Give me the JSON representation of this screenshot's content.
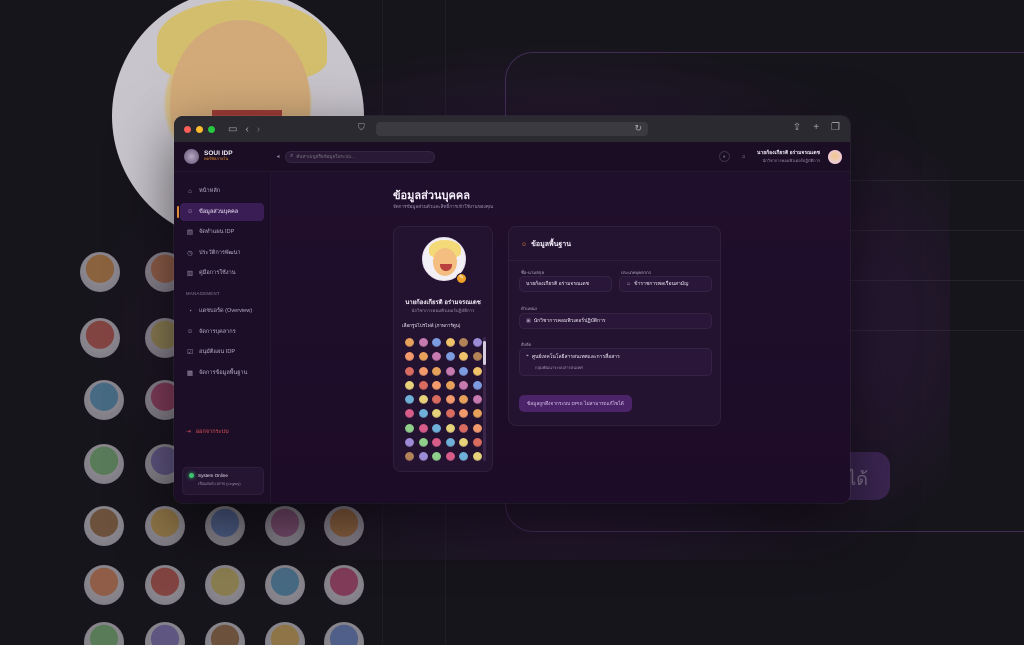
{
  "browser": {
    "controls": [
      "red",
      "yellow",
      "green"
    ]
  },
  "app": {
    "brand_name": "SOUI IDP",
    "brand_sub": "พอร์ทัลภายใน",
    "search_placeholder": "ค้นหาเมนูหรือข้อมูลในระบบ...",
    "user_name": "นายก้องเกียรติ อร่ามจรณเดช",
    "user_role": "นักวิชาการคอมพิวเตอร์ปฏิบัติการ"
  },
  "sidebar": {
    "items": [
      {
        "label": "หน้าหลัก",
        "icon": "home-icon"
      },
      {
        "label": "ข้อมูลส่วนบุคคล",
        "icon": "user-icon"
      },
      {
        "label": "จัดทำแผน IDP",
        "icon": "file-icon"
      },
      {
        "label": "ประวัติการพัฒนา",
        "icon": "history-icon"
      },
      {
        "label": "คู่มือการใช้งาน",
        "icon": "book-icon"
      }
    ],
    "section_label": "MANAGEMENT",
    "management_items": [
      {
        "label": "แดชบอร์ด (Overview)",
        "icon": "dashboard-icon"
      },
      {
        "label": "จัดการบุคลากร",
        "icon": "users-icon"
      },
      {
        "label": "อนุมัติแผน IDP",
        "icon": "check-icon"
      },
      {
        "label": "จัดการข้อมูลพื้นฐาน",
        "icon": "database-icon"
      }
    ],
    "logout_label": "ออกจากระบบ",
    "status_title": "System Online",
    "status_sub": "เชื่อมต่อกับ DPIS (Legacy)"
  },
  "page": {
    "title": "ข้อมูลส่วนบุคคล",
    "subtitle": "จัดการข้อมูลส่วนตัวและสิทธิ์การเข้าใช้งานของคุณ"
  },
  "profile": {
    "name": "นายก้องเกียรติ อร่ามจรณเดช",
    "role": "นักวิชาการคอมพิวเตอร์ปฏิบัติการ",
    "pick_label": "เลือกรูปโปรไฟล์ (ภาพการ์ตูน)"
  },
  "basic_info": {
    "title": "ข้อมูลพื้นฐาน",
    "fields": {
      "name_label": "ชื่อ-นามสกุล",
      "name_value": "นายก้องเกียรติ อร่ามจรณเดช",
      "type_label": "ประเภทบุคลากร",
      "type_value": "ข้าราชการพลเรือนสามัญ",
      "position_label": "ตำแหน่ง",
      "position_value": "นักวิชาการคอมพิวเตอร์ปฏิบัติการ",
      "org_label": "สังกัด",
      "org_value": "ศูนย์เทคโนโลยีสารสนเทศและการสื่อสาร",
      "org_sub": "กลุ่มพัฒนาระบบสารสนเทศ"
    },
    "note": "ข้อมูลถูกดึงจากระบบ DPIS ไม่สามารถแก้ไขได้"
  },
  "avatar_palette": [
    "#e8a15a",
    "#9c8bd6",
    "#d96b5f",
    "#f0c36a",
    "#6fb0d8",
    "#c77ab0",
    "#8fcf8a",
    "#f29a6b",
    "#b28357",
    "#e6d27a",
    "#7d9be0",
    "#d85c8a"
  ],
  "colors": {
    "accent": "#e08a35",
    "active_nav": "#3a1d55",
    "danger": "#e3525a",
    "online": "#3cc46e"
  }
}
